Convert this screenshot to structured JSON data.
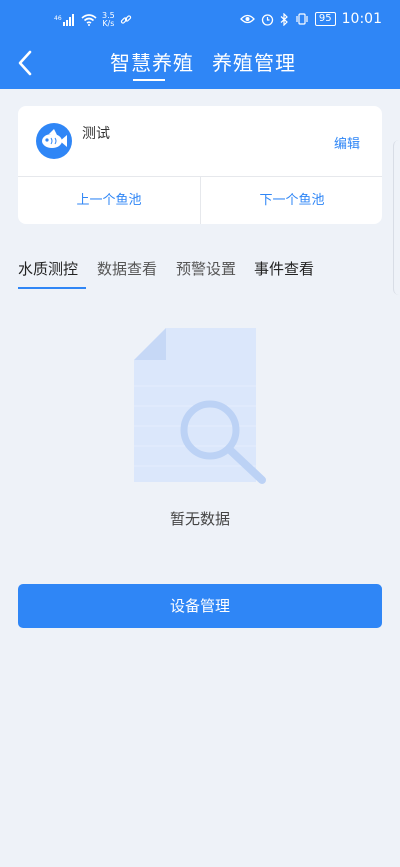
{
  "status_bar": {
    "net_speed_value": "3.5",
    "net_speed_unit": "K/s",
    "battery": "95",
    "time": "10:01"
  },
  "header": {
    "tabs": [
      {
        "label": "智慧养殖"
      },
      {
        "label": "养殖管理"
      }
    ],
    "active_tab": 0,
    "back_icon": "chevron-left-icon"
  },
  "pond_card": {
    "name": "测试",
    "edit_label": "编辑",
    "prev_label": "上一个鱼池",
    "next_label": "下一个鱼池",
    "avatar_icon": "fish-icon"
  },
  "sub_tabs": [
    {
      "label": "水质测控"
    },
    {
      "label": "数据查看"
    },
    {
      "label": "预警设置"
    },
    {
      "label": "事件查看"
    }
  ],
  "active_sub_tab": 0,
  "empty_state": {
    "text": "暂无数据",
    "icon": "empty-document-search-icon"
  },
  "primary_button": {
    "label": "设备管理"
  },
  "colors": {
    "accent": "#2f86f6",
    "background": "#eef2f8"
  }
}
